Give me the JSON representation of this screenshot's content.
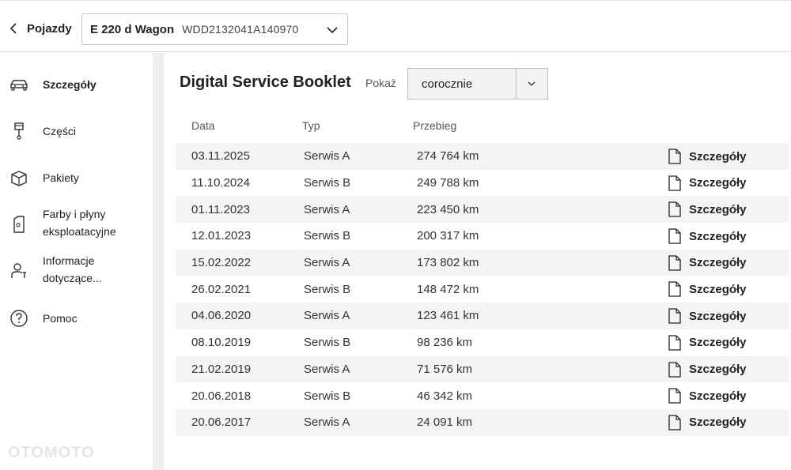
{
  "header": {
    "back_label": "Pojazdy",
    "vehicle_model": "E 220 d Wagon",
    "vehicle_vin": "WDD2132041A140970"
  },
  "sidebar": {
    "items": [
      {
        "label": "Szczegóły",
        "icon": "car-icon",
        "active": true
      },
      {
        "label": "Części",
        "icon": "piston-icon",
        "active": false
      },
      {
        "label": "Pakiety",
        "icon": "package-icon",
        "active": false
      },
      {
        "label": "Farby i płyny eksploatacyjne",
        "icon": "fluid-can-icon",
        "active": false
      },
      {
        "label": "Informacje dotyczące...",
        "icon": "mechanic-icon",
        "active": false
      },
      {
        "label": "Pomoc",
        "icon": "help-icon",
        "active": false
      }
    ]
  },
  "main": {
    "title": "Digital Service Booklet",
    "show_label": "Pokaż",
    "interval_value": "corocznie",
    "columns": {
      "date": "Data",
      "type": "Typ",
      "mileage": "Przebieg"
    },
    "details_label": "Szczegóły",
    "rows": [
      {
        "date": "03.11.2025",
        "type": "Serwis A",
        "mileage": "274 764 km"
      },
      {
        "date": "11.10.2024",
        "type": "Serwis B",
        "mileage": "249 788 km"
      },
      {
        "date": "01.11.2023",
        "type": "Serwis A",
        "mileage": "223 450 km"
      },
      {
        "date": "12.01.2023",
        "type": "Serwis B",
        "mileage": "200 317 km"
      },
      {
        "date": "15.02.2022",
        "type": "Serwis A",
        "mileage": "173 802 km"
      },
      {
        "date": "26.02.2021",
        "type": "Serwis B",
        "mileage": "148 472 km"
      },
      {
        "date": "04.06.2020",
        "type": "Serwis A",
        "mileage": "123 461 km"
      },
      {
        "date": "08.10.2019",
        "type": "Serwis B",
        "mileage": "98 236 km"
      },
      {
        "date": "21.02.2019",
        "type": "Serwis A",
        "mileage": "71 576 km"
      },
      {
        "date": "20.06.2018",
        "type": "Serwis B",
        "mileage": "46 342 km"
      },
      {
        "date": "20.06.2017",
        "type": "Serwis A",
        "mileage": "24 091 km"
      }
    ]
  },
  "watermark": "OTOMOTO"
}
